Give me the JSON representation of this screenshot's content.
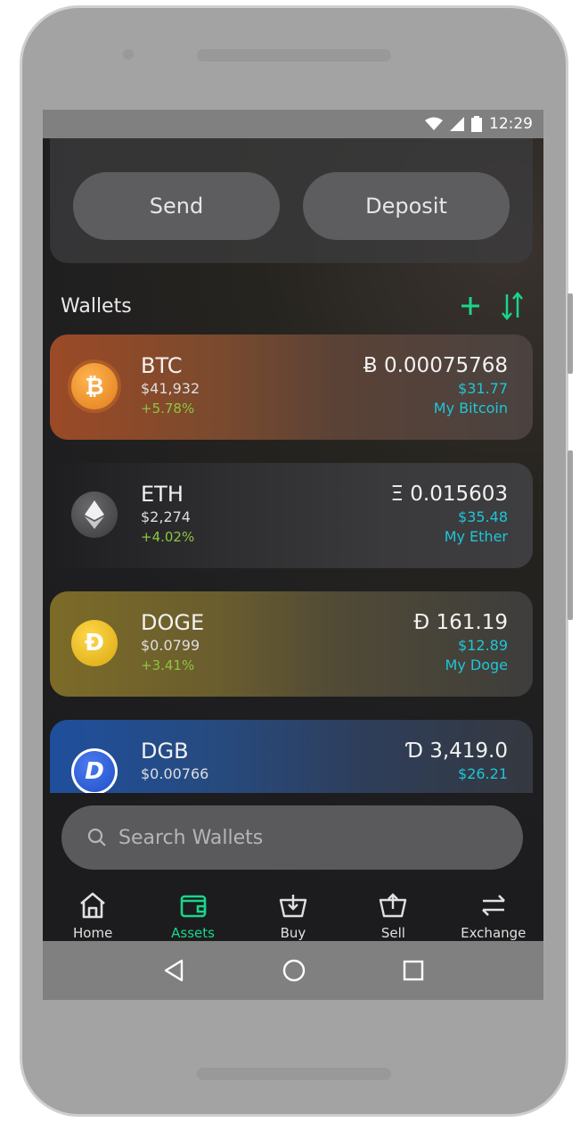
{
  "status_bar": {
    "time": "12:29"
  },
  "actions": {
    "send_label": "Send",
    "deposit_label": "Deposit"
  },
  "wallets_section": {
    "title": "Wallets"
  },
  "wallets": [
    {
      "symbol": "BTC",
      "price": "$41,932",
      "change": "+5.78%",
      "balance": "Ƀ 0.00075768",
      "usd_value": "$31.77",
      "name": "My Bitcoin",
      "icon": "bitcoin-icon",
      "color": "#f09435"
    },
    {
      "symbol": "ETH",
      "price": "$2,274",
      "change": "+4.02%",
      "balance": "Ξ 0.015603",
      "usd_value": "$35.48",
      "name": "My Ether",
      "icon": "ethereum-icon",
      "color": "#3c3c3d"
    },
    {
      "symbol": "DOGE",
      "price": "$0.0799",
      "change": "+3.41%",
      "balance": "Đ 161.19",
      "usd_value": "$12.89",
      "name": "My Doge",
      "icon": "dogecoin-icon",
      "color": "#e1b303"
    },
    {
      "symbol": "DGB",
      "price": "$0.00766",
      "change": "",
      "balance": "Ɗ 3,419.0",
      "usd_value": "$26.21",
      "name": "",
      "icon": "digibyte-icon",
      "color": "#1f57c9"
    }
  ],
  "search": {
    "placeholder": "Search Wallets"
  },
  "bottom_nav": [
    {
      "label": "Home",
      "icon": "home-icon",
      "active": false
    },
    {
      "label": "Assets",
      "icon": "wallet-icon",
      "active": true
    },
    {
      "label": "Buy",
      "icon": "buy-basket-icon",
      "active": false
    },
    {
      "label": "Sell",
      "icon": "sell-basket-icon",
      "active": false
    },
    {
      "label": "Exchange",
      "icon": "exchange-icon",
      "active": false
    }
  ],
  "colors": {
    "accent": "#19d68a",
    "teal_text": "#1ec6d8",
    "positive": "#8cc63f"
  }
}
